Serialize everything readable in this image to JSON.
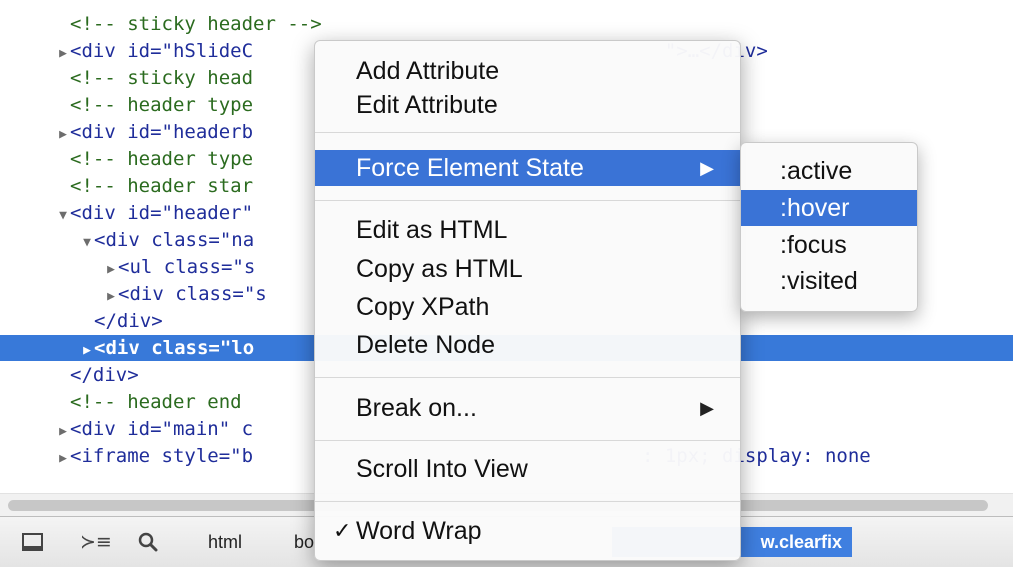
{
  "dom_lines": [
    {
      "text": "<!-- sticky header -->",
      "indent": 1,
      "toggle": "",
      "style": "comment"
    },
    {
      "text": "<div id=\"hSlideC                                    \">…</div>",
      "indent": 1,
      "toggle": "▶",
      "style": "element"
    },
    {
      "text": "<!-- sticky head",
      "indent": 1,
      "toggle": "",
      "style": "comment"
    },
    {
      "text": "<!-- header type",
      "indent": 1,
      "toggle": "",
      "style": "comment"
    },
    {
      "text": "<div id=\"headerb",
      "indent": 1,
      "toggle": "▶",
      "style": "element"
    },
    {
      "text": "<!-- header type",
      "indent": 1,
      "toggle": "",
      "style": "comment"
    },
    {
      "text": "<!-- header star",
      "indent": 1,
      "toggle": "",
      "style": "comment"
    },
    {
      "text": "<div id=\"header\"",
      "indent": 1,
      "toggle": "▼",
      "style": "element"
    },
    {
      "text": "<div class=\"na",
      "indent": 2,
      "toggle": "▼",
      "style": "element"
    },
    {
      "text": "<ul class=\"s",
      "indent": 3,
      "toggle": "▶",
      "style": "element"
    },
    {
      "text": "<div class=\"s",
      "indent": 3,
      "toggle": "▶",
      "style": "element"
    },
    {
      "text": "</div>",
      "indent": 2,
      "toggle": "",
      "style": "element"
    },
    {
      "text": "<div class=\"lo",
      "indent": 2,
      "toggle": "▶",
      "style": "selected"
    },
    {
      "text": "</div>",
      "indent": 1,
      "toggle": "",
      "style": "element"
    },
    {
      "text": "<!-- header end",
      "indent": 1,
      "toggle": "",
      "style": "comment"
    },
    {
      "text": "<div id=\"main\" c",
      "indent": 1,
      "toggle": "▶",
      "style": "element"
    },
    {
      "text": "<iframe style=\"b                                  : 1px; display: none",
      "indent": 1,
      "toggle": "▶",
      "style": "element"
    }
  ],
  "context_menu": {
    "add_attribute": "Add Attribute",
    "edit_attribute": "Edit Attribute",
    "force_element_state": "Force Element State",
    "edit_as_html": "Edit as HTML",
    "copy_as_html": "Copy as HTML",
    "copy_xpath": "Copy XPath",
    "delete_node": "Delete Node",
    "break_on": "Break on...",
    "scroll_into_view": "Scroll Into View",
    "word_wrap": "Word Wrap",
    "arrow": "▶",
    "check": "✓"
  },
  "submenu": {
    "active": ":active",
    "hover": ":hover",
    "focus": ":focus",
    "visited": ":visited"
  },
  "toolbar": {
    "crumb_html": "html",
    "crumb_body": "bo",
    "crumb_active": "w.clearfix",
    "search_glyph": "🔍",
    "console_glyph": "≻≡"
  },
  "colors": {
    "selection": "#3879d9",
    "menu_highlight": "#3a73d6",
    "code_tag": "#1f2d9a",
    "code_comment": "#2b6b1f"
  }
}
